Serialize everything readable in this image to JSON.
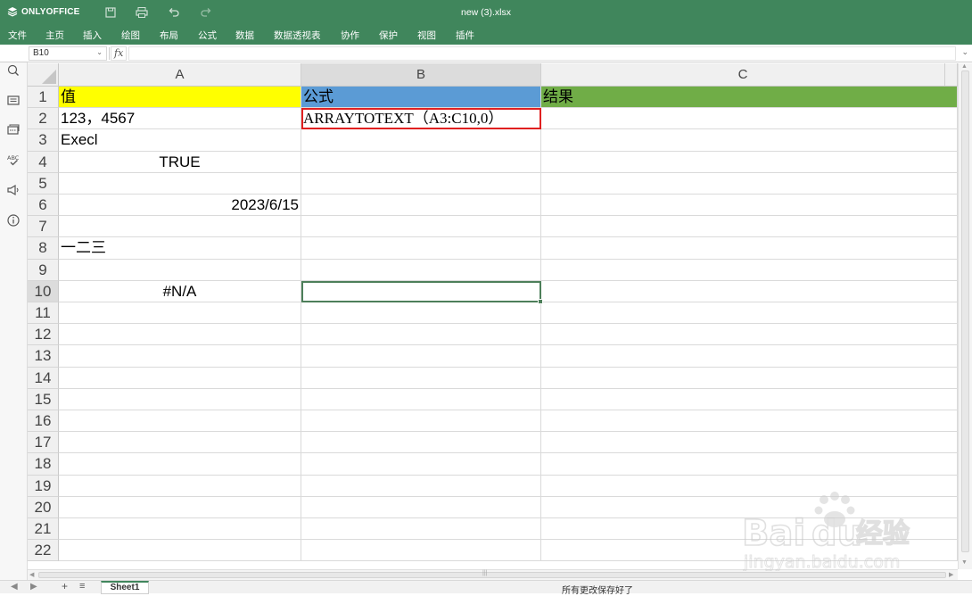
{
  "app": {
    "brand": "ONLYOFFICE",
    "document_title": "new (3).xlsx"
  },
  "toolbar": {
    "save_icon": "save-icon",
    "print_icon": "print-icon",
    "undo_icon": "undo-icon",
    "redo_icon": "redo-icon"
  },
  "menu": {
    "items": [
      "文件",
      "主页",
      "插入",
      "绘图",
      "布局",
      "公式",
      "数据",
      "数据透视表",
      "协作",
      "保护",
      "视图",
      "插件"
    ]
  },
  "formula_bar": {
    "name_box": "B10",
    "fx_label": "fx",
    "formula": ""
  },
  "sidebar": {
    "icons": [
      "search-icon",
      "comments-icon",
      "chat-icon",
      "spellcheck-icon",
      "feedback-icon",
      "about-icon"
    ]
  },
  "grid": {
    "columns": [
      "A",
      "B",
      "C"
    ],
    "rows": [
      "1",
      "2",
      "3",
      "4",
      "5",
      "6",
      "7",
      "8",
      "9",
      "10",
      "11",
      "12",
      "13",
      "14",
      "15",
      "16",
      "17",
      "18",
      "19",
      "20",
      "21",
      "22"
    ],
    "cells": {
      "A1": "值",
      "B1": "公式",
      "C1": "结果",
      "A2": "123，4567",
      "B2": "ARRAYTOTEXT（A3:C10,0）",
      "A3": "Execl",
      "A4": "TRUE",
      "A6": "2023/6/15",
      "A8": "一二三",
      "A10": "#N/A"
    },
    "fill_colors": {
      "A1": "#ffff00",
      "B1": "#5b9bd5",
      "C1": "#70ad47"
    },
    "selected_cell": "B10",
    "highlighted_cell": "B2",
    "highlight_color": "#e02020"
  },
  "status_bar": {
    "sheet_tab": "Sheet1",
    "save_status": "所有更改保存好了"
  },
  "colors": {
    "accent": "#40865c"
  },
  "watermark": {
    "brand": "Bai du 经验",
    "url": "jingyan.baidu.com"
  }
}
